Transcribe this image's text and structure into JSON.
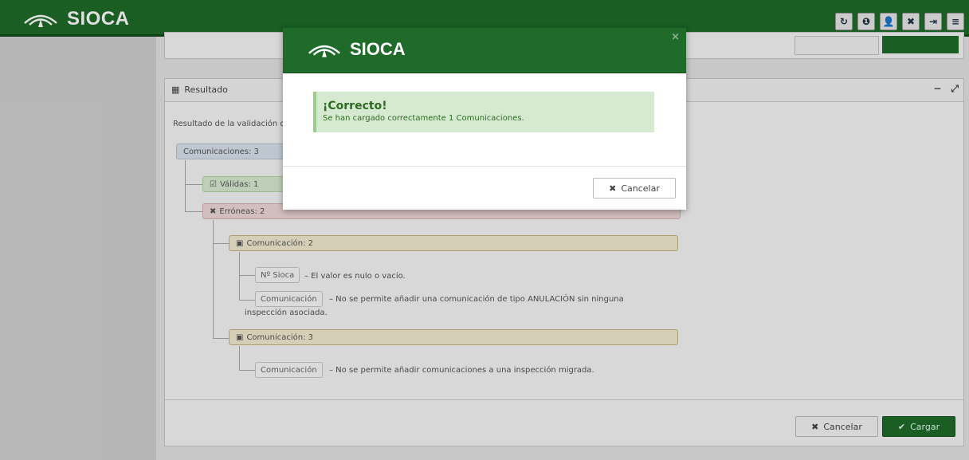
{
  "topbar": {
    "app_name": "SIOCA",
    "icons": [
      "refresh-icon",
      "info-icon",
      "user-icon",
      "close-square-icon",
      "logout-icon",
      "menu-icon"
    ],
    "icon_glyphs": [
      "↻",
      "❶",
      "👤",
      "✖",
      "⇥",
      "≡"
    ]
  },
  "panel": {
    "title": "Resultado",
    "intro": "Resultado de la validación d",
    "tree": {
      "root": "Comunicaciones: 3",
      "valid": "Válidas: 1",
      "errors": "Erróneas: 2",
      "com2": "Comunicación: 2",
      "com2_field1": "Nº Sioca",
      "com2_msg1": "– El valor es nulo o vacío.",
      "com2_field2": "Comunicación",
      "com2_msg2_line1": "– No se permite añadir una comunicación de tipo ANULACIÓN sin ninguna",
      "com2_msg2_line2": "inspección asociada.",
      "com3": "Comunicación: 3",
      "com3_field1": "Comunicación",
      "com3_msg1": "– No se permite añadir comunicaciones a una inspección migrada."
    },
    "buttons": {
      "cancel": "Cancelar",
      "load": "Cargar"
    }
  },
  "modal": {
    "app_name": "SIOCA",
    "alert_title": "¡Correcto!",
    "alert_text": "Se han cargado correctamente 1 Comunicaciones.",
    "cancel_label": "Cancelar"
  },
  "colors": {
    "brand": "#1e6b2a",
    "success_bg": "#d6ead2"
  }
}
